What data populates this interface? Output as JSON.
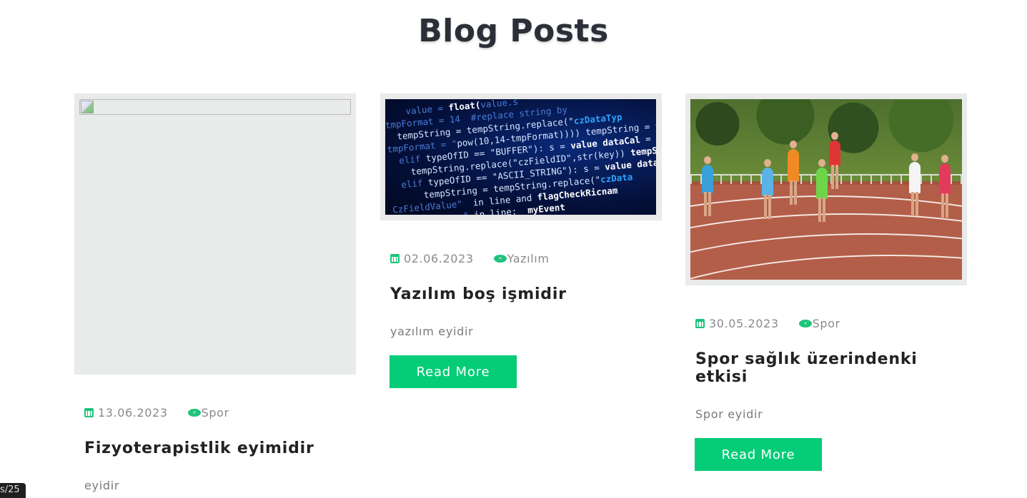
{
  "page_title": "Blog Posts",
  "accent_color": "#05cc77",
  "posts": [
    {
      "image": "broken-image",
      "date": "13.06.2023",
      "category": "Spor",
      "title": "Fizyoterapistlik eyimidir",
      "excerpt": "eyidir",
      "read_more": ""
    },
    {
      "image": "code-screen",
      "date": "02.06.2023",
      "category": "Yazılım",
      "title": "Yazılım boş işmidir",
      "excerpt": "yazılım eyidir",
      "read_more": "Read More"
    },
    {
      "image": "running-track",
      "date": "30.05.2023",
      "category": "Spor",
      "title": "Spor sağlık üzerindenki etkisi",
      "excerpt": "Spor eyidir",
      "read_more": "Read More"
    }
  ],
  "status_chip": "s/25"
}
